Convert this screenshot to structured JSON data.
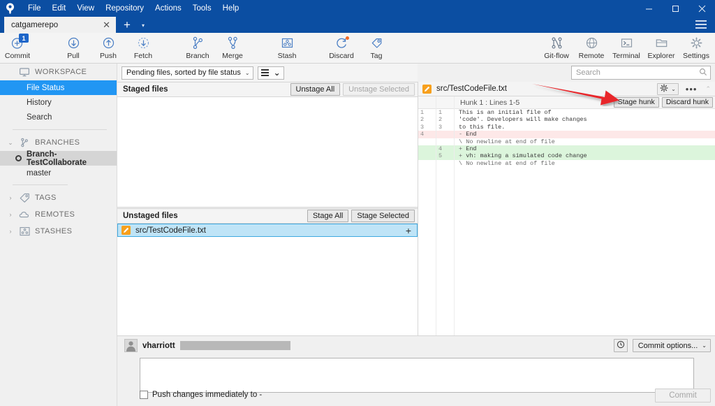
{
  "window": {
    "app_icon": "sourcetree-logo-icon",
    "minimize_label": "─",
    "maximize_label": "□",
    "close_label": "✕"
  },
  "menubar": {
    "items": [
      {
        "label": "File",
        "name": "menu-file"
      },
      {
        "label": "Edit",
        "name": "menu-edit"
      },
      {
        "label": "View",
        "name": "menu-view"
      },
      {
        "label": "Repository",
        "name": "menu-repository"
      },
      {
        "label": "Actions",
        "name": "menu-actions"
      },
      {
        "label": "Tools",
        "name": "menu-tools"
      },
      {
        "label": "Help",
        "name": "menu-help"
      }
    ]
  },
  "tabs": {
    "active": "catgamerepo",
    "close_label": "✕",
    "new_tab_label": "+",
    "new_tab_dropdown_label": "▾"
  },
  "toolbar": {
    "left": [
      {
        "label": "Commit",
        "icon": "commit-plus-icon",
        "badge": "1"
      },
      {
        "label": "Pull",
        "icon": "pull-down-arrow-icon"
      },
      {
        "label": "Push",
        "icon": "push-up-arrow-icon"
      },
      {
        "label": "Fetch",
        "icon": "fetch-dashed-arrow-icon"
      },
      {
        "label": "Branch",
        "icon": "branch-icon"
      },
      {
        "label": "Merge",
        "icon": "merge-icon"
      },
      {
        "label": "Stash",
        "icon": "stash-icon"
      },
      {
        "label": "Discard",
        "icon": "discard-refresh-icon"
      },
      {
        "label": "Tag",
        "icon": "tag-icon"
      }
    ],
    "right": [
      {
        "label": "Git-flow",
        "icon": "gitflow-icon"
      },
      {
        "label": "Remote",
        "icon": "globe-icon"
      },
      {
        "label": "Terminal",
        "icon": "terminal-icon"
      },
      {
        "label": "Explorer",
        "icon": "folder-icon"
      },
      {
        "label": "Settings",
        "icon": "gear-icon"
      }
    ]
  },
  "sidebar": {
    "workspace": {
      "label": "WORKSPACE",
      "icon": "monitor-icon",
      "items": [
        {
          "label": "File Status",
          "selected": true
        },
        {
          "label": "History",
          "selected": false
        },
        {
          "label": "Search",
          "selected": false
        }
      ]
    },
    "branches": {
      "label": "BRANCHES",
      "icon": "branch-icon",
      "expanded": true,
      "caret": "⌄",
      "items": [
        {
          "label": "Branch-TestCollaborate",
          "current": true
        },
        {
          "label": "master",
          "current": false
        }
      ]
    },
    "tags": {
      "label": "TAGS",
      "icon": "tag-icon",
      "caret": "›"
    },
    "remotes": {
      "label": "REMOTES",
      "icon": "cloud-icon",
      "caret": "›"
    },
    "stashes": {
      "label": "STASHES",
      "icon": "stash-icon",
      "caret": "›"
    }
  },
  "filterbar": {
    "sort_value": "Pending files, sorted by file status",
    "sort_caret": "⌄",
    "view_caret": "⌄"
  },
  "search": {
    "placeholder": "Search",
    "value": "",
    "icon": "search-icon"
  },
  "staged": {
    "title": "Staged files",
    "unstage_all": "Unstage All",
    "unstage_selected": "Unstage Selected",
    "files": []
  },
  "unstaged": {
    "title": "Unstaged files",
    "stage_all": "Stage All",
    "stage_selected": "Stage Selected",
    "files": [
      {
        "path": "src/TestCodeFile.txt",
        "status_icon": "modified-pencil-icon",
        "stage_button": "+",
        "selected": true
      }
    ]
  },
  "diff": {
    "filename": "src/TestCodeFile.txt",
    "file_icon": "modified-pencil-icon",
    "gear_icon": "gear-icon",
    "gear_caret": "⌄",
    "more_label": "•••",
    "collapse_caret": "⌃",
    "hunk_title": "Hunk 1 : Lines 1-5",
    "stage_hunk": "Stage hunk",
    "discard_hunk": "Discard hunk",
    "lines": [
      {
        "old": "1",
        "new": "1",
        "type": "context",
        "sign": "",
        "text": "This is an initial file of "
      },
      {
        "old": "2",
        "new": "2",
        "type": "context",
        "sign": "",
        "text": "'code'. Developers will make changes "
      },
      {
        "old": "3",
        "new": "3",
        "type": "context",
        "sign": "",
        "text": "to this file."
      },
      {
        "old": "4",
        "new": "",
        "type": "delete",
        "sign": "-",
        "text": "End"
      },
      {
        "old": "",
        "new": "",
        "type": "meta",
        "sign": "\\",
        "text": "No newline at end of file"
      },
      {
        "old": "",
        "new": "4",
        "type": "add",
        "sign": "+",
        "text": "End"
      },
      {
        "old": "",
        "new": "5",
        "type": "add",
        "sign": "+",
        "text": "vh: making a simulated code change"
      },
      {
        "old": "",
        "new": "",
        "type": "meta",
        "sign": "\\",
        "text": "No newline at end of file"
      }
    ]
  },
  "commit": {
    "author": "vharriott",
    "author_email_redacted": true,
    "avatar_icon": "user-avatar-icon",
    "clock_icon": "history-clock-icon",
    "options_label": "Commit options...",
    "options_caret": "⌄",
    "message_value": "",
    "message_placeholder": "",
    "push_checkbox_label": "Push changes immediately to -",
    "push_checked": false,
    "commit_button": "Commit",
    "commit_enabled": false
  },
  "annotation": {
    "arrow_color": "#e8262a",
    "points_to": "Stage hunk"
  },
  "colors": {
    "titlebar": "#0b4ea2",
    "accent_selected": "#2196f3",
    "diff_add_bg": "#dcf5dc",
    "diff_del_bg": "#fde8e8",
    "file_icon": "#f7a01d",
    "badge": "#1d66c9"
  }
}
